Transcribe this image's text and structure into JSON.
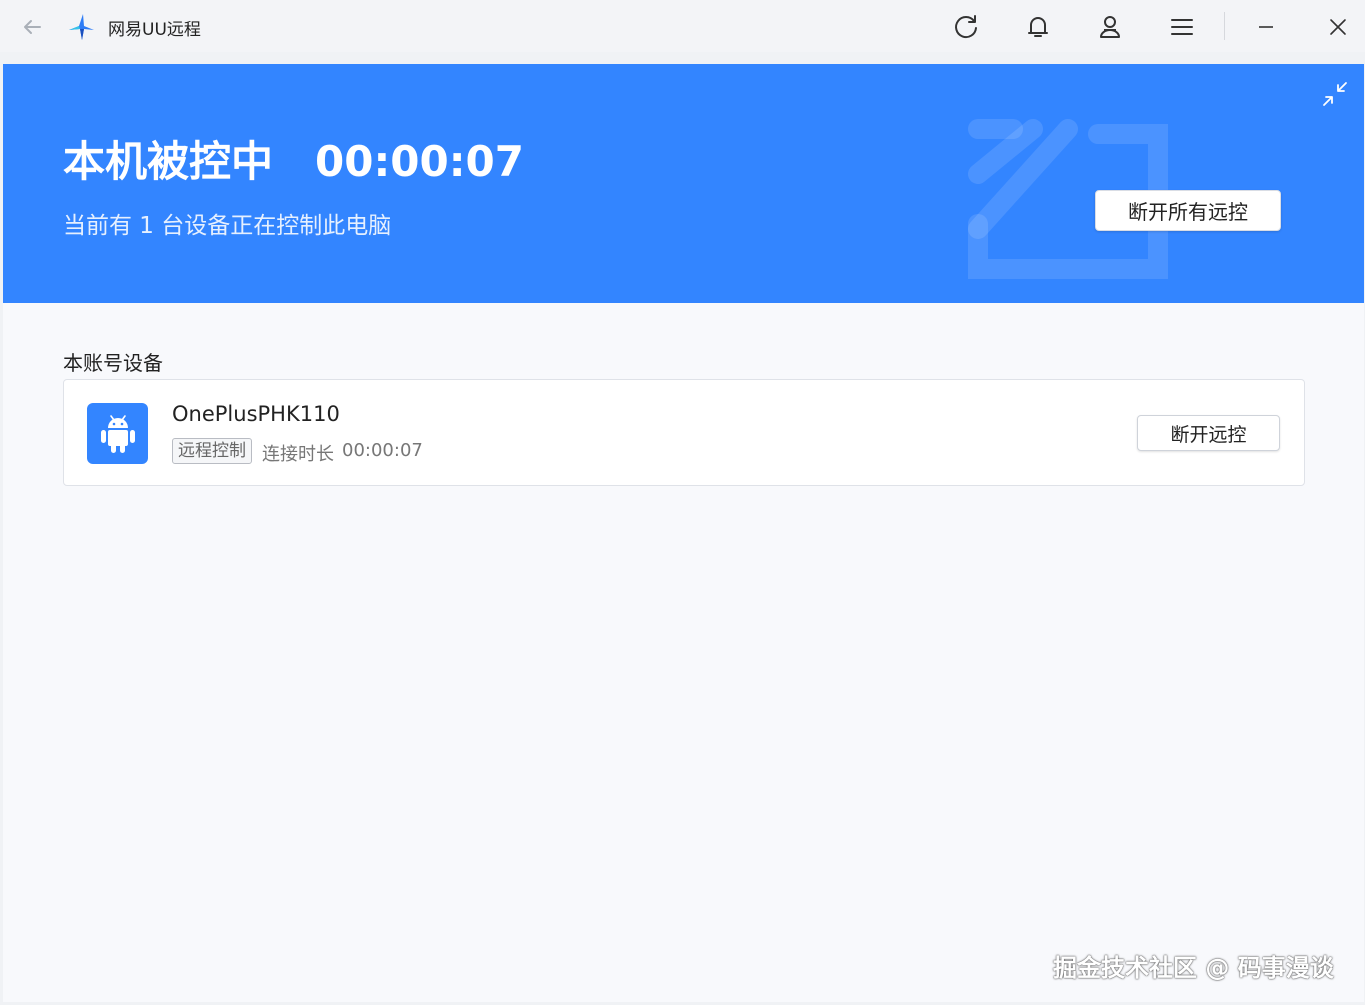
{
  "titlebar": {
    "app_title": "网易UU远程",
    "icons": [
      "back-arrow-icon",
      "app-logo-icon",
      "refresh-icon",
      "bell-icon",
      "user-icon",
      "menu-icon",
      "minimize-icon",
      "close-icon"
    ]
  },
  "banner": {
    "status_title": "本机被控中",
    "timer": "00:00:07",
    "subtitle": "当前有 1 台设备正在控制此电脑",
    "disconnect_all_label": "断开所有远控",
    "background_color": "#3385ff"
  },
  "devices_section": {
    "title": "本账号设备",
    "devices": [
      {
        "name": "OnePlusPHK110",
        "icon": "android-icon",
        "tag": "远程控制",
        "duration_label": "连接时长",
        "duration": "00:00:07",
        "disconnect_label": "断开远控"
      }
    ]
  },
  "watermark": "掘金技术社区 @ 码事漫谈"
}
